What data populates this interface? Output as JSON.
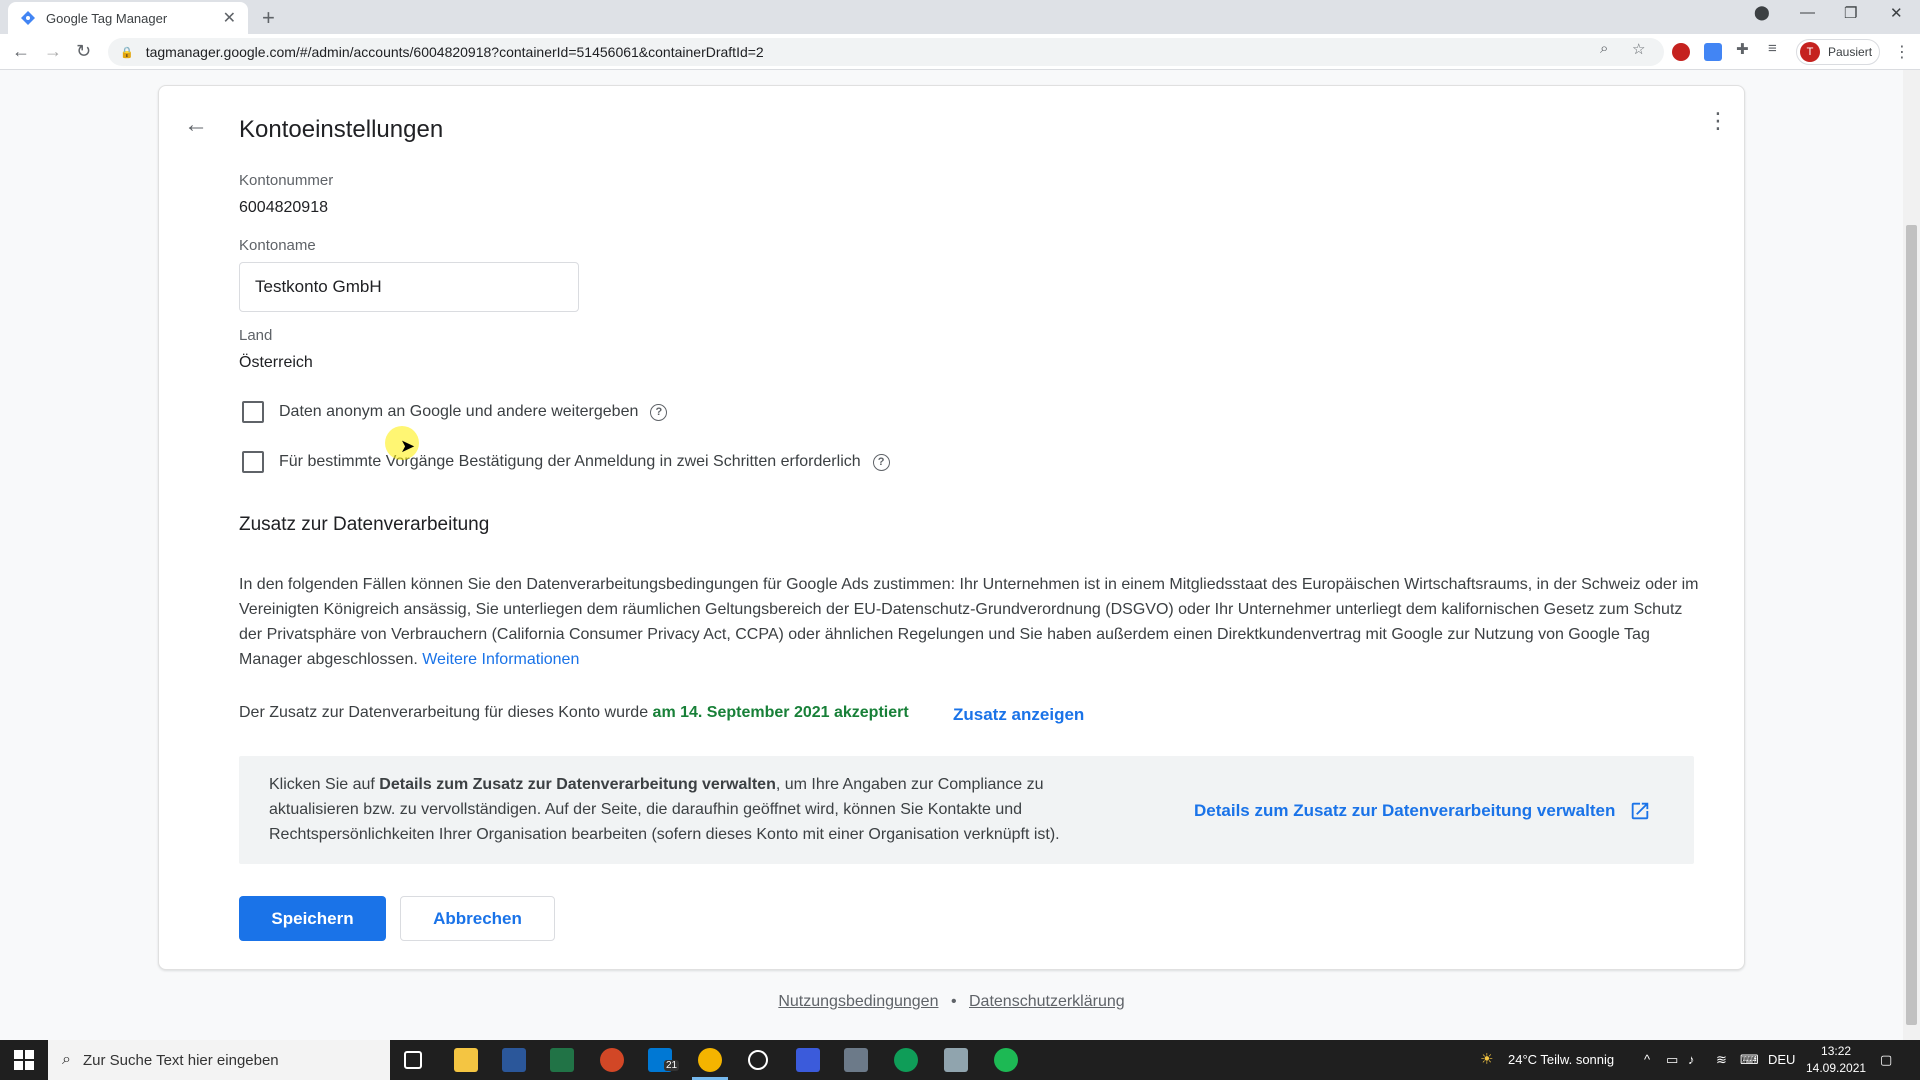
{
  "browser": {
    "tab_title": "Google Tag Manager",
    "url": "tagmanager.google.com/#/admin/accounts/6004820918?containerId=51456061&containerDraftId=2",
    "profile_initial": "T",
    "profile_status": "Pausiert"
  },
  "page": {
    "title": "Kontoeinstellungen",
    "account_number_label": "Kontonummer",
    "account_number": "6004820918",
    "account_name_label": "Kontoname",
    "account_name_value": "Testkonto GmbH",
    "country_label": "Land",
    "country": "Österreich",
    "checkbox_share_data": "Daten anonym an Google und andere weitergeben",
    "checkbox_two_step": "Für bestimmte Vorgänge Bestätigung der Anmeldung in zwei Schritten erforderlich",
    "section_title": "Zusatz zur Datenverarbeitung",
    "paragraph": "In den folgenden Fällen können Sie den Datenverarbeitungsbedingungen für Google Ads zustimmen: Ihr Unternehmen ist in einem Mitgliedsstaat des Europäischen Wirtschaftsraums, in der Schweiz oder im Vereinigten Königreich ansässig, Sie unterliegen dem räumlichen Geltungsbereich der EU-Datenschutz-Grundverordnung (DSGVO) oder Ihr Unternehmer unterliegt dem kalifornischen Gesetz zum Schutz der Privatsphäre von Verbrauchern (California Consumer Privacy Act, CCPA) oder ähnlichen Regelungen und Sie haben außerdem einen Direktkundenvertrag mit Google zur Nutzung von Google Tag Manager abgeschlossen.",
    "more_info_link": "Weitere Informationen",
    "accepted_prefix": "Der Zusatz zur Datenverarbeitung für dieses Konto wurde",
    "accepted_date": "am 14. September 2021 akzeptiert",
    "show_addon_link": "Zusatz anzeigen",
    "info_prefix": "Klicken Sie auf",
    "info_bold": "Details zum Zusatz zur Datenverarbeitung verwalten",
    "info_suffix": ", um Ihre Angaben zur Compliance zu aktualisieren bzw. zu vervollständigen. Auf der Seite, die daraufhin geöffnet wird, können Sie Kontakte und Rechtspersönlichkeiten Ihrer Organisation bearbeiten (sofern dieses Konto mit einer Organisation verknüpft ist).",
    "manage_link": "Details zum Zusatz zur Datenverarbeitung verwalten",
    "save_button": "Speichern",
    "cancel_button": "Abbrechen"
  },
  "footer": {
    "terms": "Nutzungsbedingungen",
    "separator": "•",
    "privacy": "Datenschutzerklärung"
  },
  "taskbar": {
    "search_placeholder": "Zur Suche Text hier eingeben",
    "weather": "24°C  Teilw. sonnig",
    "language": "DEU",
    "time": "13:22",
    "date": "14.09.2021",
    "mail_badge": "21"
  },
  "colors": {
    "accent": "#1a73e8",
    "accepted_green": "#188038"
  }
}
